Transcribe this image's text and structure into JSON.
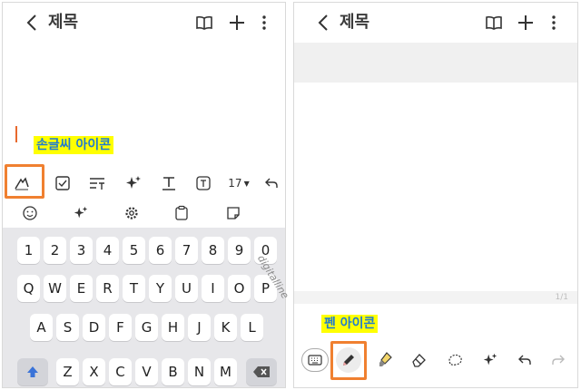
{
  "left": {
    "header": {
      "title": "제목",
      "back_icon": "chevron-left-icon",
      "icons": [
        "book-open-icon",
        "plus-icon",
        "more-vertical-icon"
      ]
    },
    "callout": "손글씨 아이콘",
    "toolbar": {
      "font_size": "17"
    },
    "keyboard": {
      "row1": [
        "1",
        "2",
        "3",
        "4",
        "5",
        "6",
        "7",
        "8",
        "9",
        "0"
      ],
      "row2": [
        "Q",
        "W",
        "E",
        "R",
        "T",
        "Y",
        "U",
        "I",
        "O",
        "P"
      ],
      "row3": [
        "A",
        "S",
        "D",
        "F",
        "G",
        "H",
        "J",
        "K",
        "L"
      ],
      "row4": [
        "Z",
        "X",
        "C",
        "V",
        "B",
        "N",
        "M"
      ]
    }
  },
  "right": {
    "header": {
      "title": "제목"
    },
    "page_indicator": "1/1",
    "callout": "펜 아이콘"
  },
  "watermark": "digitalline",
  "colors": {
    "highlight": "#f08030",
    "callout_bg": "#ffff00",
    "callout_text": "#1f7ad1",
    "caret": "#e8692e"
  }
}
